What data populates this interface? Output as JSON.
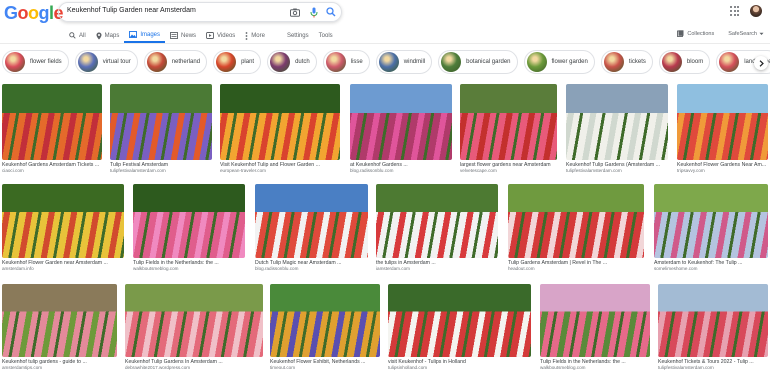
{
  "logo": [
    "G",
    "o",
    "o",
    "g",
    "l",
    "e"
  ],
  "logo_colors": [
    "#4285f4",
    "#ea4335",
    "#fbbc05",
    "#4285f4",
    "#34a853",
    "#ea4335"
  ],
  "search": {
    "query": "Keukenhof Tulip Garden near Amsterdam"
  },
  "nav": {
    "tabs": [
      {
        "label": "All",
        "icon": "search-icon"
      },
      {
        "label": "Maps",
        "icon": "map-pin-icon"
      },
      {
        "label": "Images",
        "icon": "image-icon",
        "active": true
      },
      {
        "label": "News",
        "icon": "news-icon"
      },
      {
        "label": "Videos",
        "icon": "play-icon"
      },
      {
        "label": "More",
        "icon": "more-vert-icon"
      }
    ],
    "settings": "Settings",
    "tools": "Tools",
    "collections": "Collections",
    "safesearch": "SafeSearch"
  },
  "chips": [
    {
      "label": "flower fields",
      "color": "#d94b5a"
    },
    {
      "label": "virtual tour",
      "color": "#5b6fb8"
    },
    {
      "label": "netherland",
      "color": "#c64a3a"
    },
    {
      "label": "plant",
      "color": "#d8462c"
    },
    {
      "label": "dutch",
      "color": "#7c3b6e"
    },
    {
      "label": "lisse",
      "color": "#cf5a6b"
    },
    {
      "label": "windmill",
      "color": "#4c6fa8"
    },
    {
      "label": "botanical garden",
      "color": "#4e7d3b"
    },
    {
      "label": "flower garden",
      "color": "#6c9a3b"
    },
    {
      "label": "tickets",
      "color": "#c9534a"
    },
    {
      "label": "bloom",
      "color": "#b8394e"
    },
    {
      "label": "landscape",
      "color": "#d44f5a"
    }
  ],
  "results": [
    {
      "title": "Keukenhof Gardens Amsterdam Tickets ...",
      "source": "ciaoci.com",
      "colors": [
        "#3a6d2a",
        "#e46a2b",
        "#c12f3a"
      ]
    },
    {
      "title": "Tulip Festival Amsterdam",
      "source": "tulipfestivalamsterdam.com",
      "colors": [
        "#4b7a35",
        "#7a5fc2",
        "#e35a2a"
      ]
    },
    {
      "title": "Visit Keukenhof Tulip and Flower Garden ...",
      "source": "european-traveler.com",
      "colors": [
        "#2d5a1e",
        "#f2a531",
        "#d9432e"
      ]
    },
    {
      "title": "at Keukenhof Gardens ...",
      "source": "blog.radissonblu.com",
      "colors": [
        "#6d9bd1",
        "#b03a6a",
        "#e0559b"
      ]
    },
    {
      "title": "largest flower gardens near Amsterdam",
      "source": "velvetescape.com",
      "colors": [
        "#5a7d3a",
        "#e85a7a",
        "#c3302d"
      ]
    },
    {
      "title": "Keukenhof Tulip Gardens (Amsterdam ...",
      "source": "tulipfestivalamsterdam.com",
      "colors": [
        "#8aa1b8",
        "#f0f0ea",
        "#d0d8cf"
      ]
    },
    {
      "title": "Keukenhof Flower Gardens Near Am...",
      "source": "tripsavvy.com",
      "colors": [
        "#8fbfe0",
        "#e04a3c",
        "#f09a3a"
      ]
    },
    {
      "title": "Keukenhof Flower Garden near Amsterdam ...",
      "source": "amsterdam.info",
      "colors": [
        "#3b6a22",
        "#e8c33a",
        "#d14a2e"
      ]
    },
    {
      "title": "Tulip Fields in the Netherlands: the ...",
      "source": "walkboutsmeblog.com",
      "colors": [
        "#2d5a1e",
        "#e05d8c",
        "#f08ac0"
      ]
    },
    {
      "title": "Dutch Tulip Magic near Amsterdam ...",
      "source": "blog.radissonblu.com",
      "colors": [
        "#4a7fc4",
        "#e04a3c",
        "#f2f2f2"
      ]
    },
    {
      "title": "the tulips in Amsterdam ...",
      "source": "iamsterdam.com",
      "colors": [
        "#4d7a32",
        "#f2f2f2",
        "#d83a3c"
      ]
    },
    {
      "title": "Tulip Gardens Amsterdam | Revel in The ...",
      "source": "headout.com",
      "colors": [
        "#6f9a3f",
        "#d43a3a",
        "#f2d6d8"
      ]
    },
    {
      "title": "Amsterdam to Keukenhof: The Tulip ...",
      "source": "somelimeshome.com",
      "colors": [
        "#7ea84b",
        "#b4c4e0",
        "#d05a8a"
      ]
    },
    {
      "title": "Keukenhof tulip gardens - guide to ...",
      "source": "amsterdamtips.com",
      "colors": [
        "#8a7a5a",
        "#e48a9a",
        "#6e9a3a"
      ]
    },
    {
      "title": "Keukenhof Tulip Gardens In Amsterdam ...",
      "source": "debrawhite2017.wordpress.com",
      "colors": [
        "#7a9a4a",
        "#e46a7a",
        "#f0c0c8"
      ]
    },
    {
      "title": "Keukenhof Flower Exhibit, Netherlands ...",
      "source": "timeout.com",
      "colors": [
        "#4a8a3a",
        "#e0a030",
        "#5a4fb0"
      ]
    },
    {
      "title": "visit Keukenhof - Tulips in Holland",
      "source": "tulipsinholland.com",
      "colors": [
        "#3a6a2a",
        "#d43a3a",
        "#f4f4f0"
      ]
    },
    {
      "title": "Tulip Fields in the Netherlands: the ...",
      "source": "walkboutsmeblog.com",
      "colors": [
        "#d8a4c8",
        "#e66a8a",
        "#5a8a3a"
      ]
    },
    {
      "title": "Keukenhof Tickets & Tours 2022 - Tulip ...",
      "source": "tulipfestivalamsterdam.com",
      "colors": [
        "#a3bbd4",
        "#d8495a",
        "#e7a1b0"
      ]
    }
  ]
}
